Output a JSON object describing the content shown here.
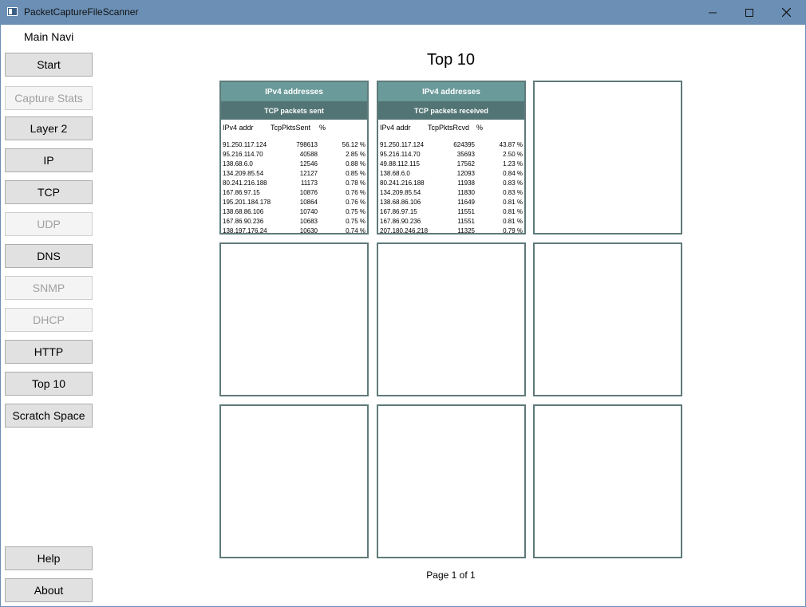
{
  "window": {
    "title": "PacketCaptureFileScanner"
  },
  "nav": {
    "heading": "Main Navi",
    "buttons": [
      {
        "label": "Start",
        "enabled": true
      },
      {
        "label": "Capture Stats",
        "enabled": false
      },
      {
        "label": "Layer 2",
        "enabled": true
      },
      {
        "label": "IP",
        "enabled": true
      },
      {
        "label": "TCP",
        "enabled": true
      },
      {
        "label": "UDP",
        "enabled": false
      },
      {
        "label": "DNS",
        "enabled": true
      },
      {
        "label": "SNMP",
        "enabled": false
      },
      {
        "label": "DHCP",
        "enabled": false
      },
      {
        "label": "HTTP",
        "enabled": true
      },
      {
        "label": "Top 10",
        "enabled": true
      },
      {
        "label": "Scratch Space",
        "enabled": true
      }
    ],
    "bottom_buttons": [
      {
        "label": "Help"
      },
      {
        "label": "About"
      }
    ]
  },
  "page": {
    "title": "Top 10",
    "footer": "Page 1 of 1"
  },
  "tiles": [
    {
      "title": "IPv4 addresses",
      "subtitle": "TCP packets sent",
      "columns": [
        "IPv4 addr",
        "TcpPktsSent",
        "%"
      ],
      "rows": [
        [
          "91.250.117.124",
          "798613",
          "56.12 %"
        ],
        [
          "95.216.114.70",
          "40588",
          "2.85 %"
        ],
        [
          "138.68.6.0",
          "12546",
          "0.88 %"
        ],
        [
          "134.209.85.54",
          "12127",
          "0.85 %"
        ],
        [
          "80.241.216.188",
          "11173",
          "0.78 %"
        ],
        [
          "167.86.97.15",
          "10876",
          "0.76 %"
        ],
        [
          "195.201.184.178",
          "10864",
          "0.76 %"
        ],
        [
          "138.68.86.106",
          "10740",
          "0.75 %"
        ],
        [
          "167.86.90.236",
          "10683",
          "0.75 %"
        ],
        [
          "138.197.176.24",
          "10630",
          "0.74 %"
        ]
      ]
    },
    {
      "title": "IPv4 addresses",
      "subtitle": "TCP packets received",
      "columns": [
        "IPv4 addr",
        "TcpPktsRcvd",
        "%"
      ],
      "rows": [
        [
          "91.250.117.124",
          "624395",
          "43.87 %"
        ],
        [
          "95.216.114.70",
          "35693",
          "2.50 %"
        ],
        [
          "49.88.112.115",
          "17562",
          "1.23 %"
        ],
        [
          "138.68.6.0",
          "12093",
          "0.84 %"
        ],
        [
          "80.241.216.188",
          "11938",
          "0.83 %"
        ],
        [
          "134.209.85.54",
          "11830",
          "0.83 %"
        ],
        [
          "138.68.86.106",
          "11649",
          "0.81 %"
        ],
        [
          "167.86.97.15",
          "11551",
          "0.81 %"
        ],
        [
          "167.86.90.236",
          "11551",
          "0.81 %"
        ],
        [
          "207.180.246.218",
          "11325",
          "0.79 %"
        ]
      ]
    }
  ],
  "colors": {
    "titlebar": "#6b8fb5",
    "tile_border": "#5f7a7a",
    "tile_header": "#6a9a9a",
    "tile_subheader": "#537474"
  }
}
